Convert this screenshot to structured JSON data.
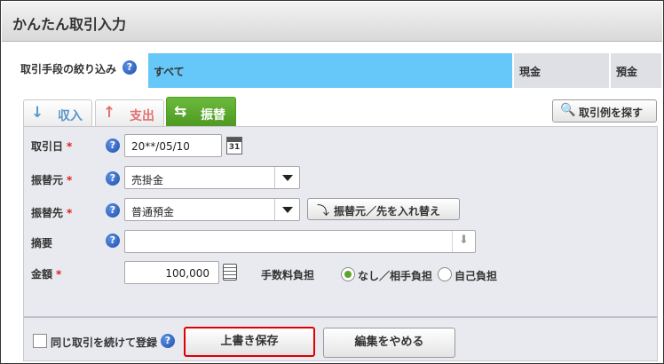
{
  "window": {
    "title": "かんたん取引入力"
  },
  "filter": {
    "label": "取引手段の絞り込み",
    "help": "?",
    "segments": [
      "すべて",
      "現金",
      "預金"
    ]
  },
  "tabs": {
    "income": {
      "label": "収入",
      "icon": "↓"
    },
    "expense": {
      "label": "支出",
      "icon": "↑"
    },
    "transfer": {
      "label": "振替",
      "icon": "⇆"
    }
  },
  "example_button": {
    "label": "取引例を探す",
    "icon": "🔍"
  },
  "form": {
    "required_mark": "*",
    "help": "?",
    "date": {
      "label": "取引日",
      "value": "20**/05/10",
      "calendar_icon": "31"
    },
    "from": {
      "label": "振替元",
      "value": "売掛金"
    },
    "to": {
      "label": "振替先",
      "value": "普通預金"
    },
    "swap_button": {
      "label": "振替元／先を入れ替え",
      "icon": "⤵"
    },
    "memo": {
      "label": "摘要",
      "value": "",
      "scroll_icon": "⬇"
    },
    "amount": {
      "label": "金額",
      "value": "100,000"
    },
    "fee": {
      "label": "手数料負担",
      "options": [
        "なし／相手負担",
        "自己負担"
      ],
      "selected": "なし／相手負担"
    }
  },
  "footer": {
    "repeat_label": "同じ取引を続けて登録",
    "help": "?",
    "overwrite_label": "上書き保存",
    "cancel_label": "編集をやめる"
  },
  "colors": {
    "active_segment": "#66c8f8",
    "transfer_tab": "#5aa52a",
    "required": "#e02020",
    "highlight_border": "#e00000"
  }
}
